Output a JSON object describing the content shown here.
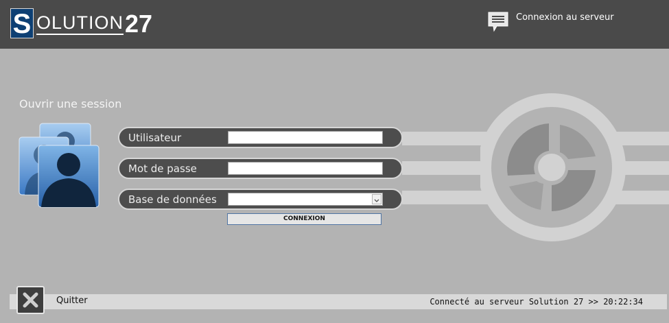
{
  "header": {
    "logo_letter": "S",
    "logo_text": "OLUTION",
    "logo_number": "27",
    "server_link_label": "Connexion au serveur",
    "server_link_icon": "chat-list-icon"
  },
  "login": {
    "title": "Ouvrir une session",
    "users_icon": "users-icon",
    "fields": [
      {
        "label": "Utilisateur",
        "value": ""
      },
      {
        "label": "Mot de passe",
        "value": ""
      },
      {
        "label": "Base de données",
        "value": ""
      }
    ],
    "connect_label": "CONNEXION"
  },
  "footer": {
    "quit_label": "Quitter",
    "quit_icon": "close-icon",
    "status": "Connecté au serveur Solution 27 >> 20:22:34"
  },
  "colors": {
    "header_bg": "#4a4a4a",
    "page_bg": "#b3b3b3",
    "logo_blue": "#0d3f73",
    "field_bg": "#4d4d4d",
    "button_border": "#4f74a3"
  }
}
